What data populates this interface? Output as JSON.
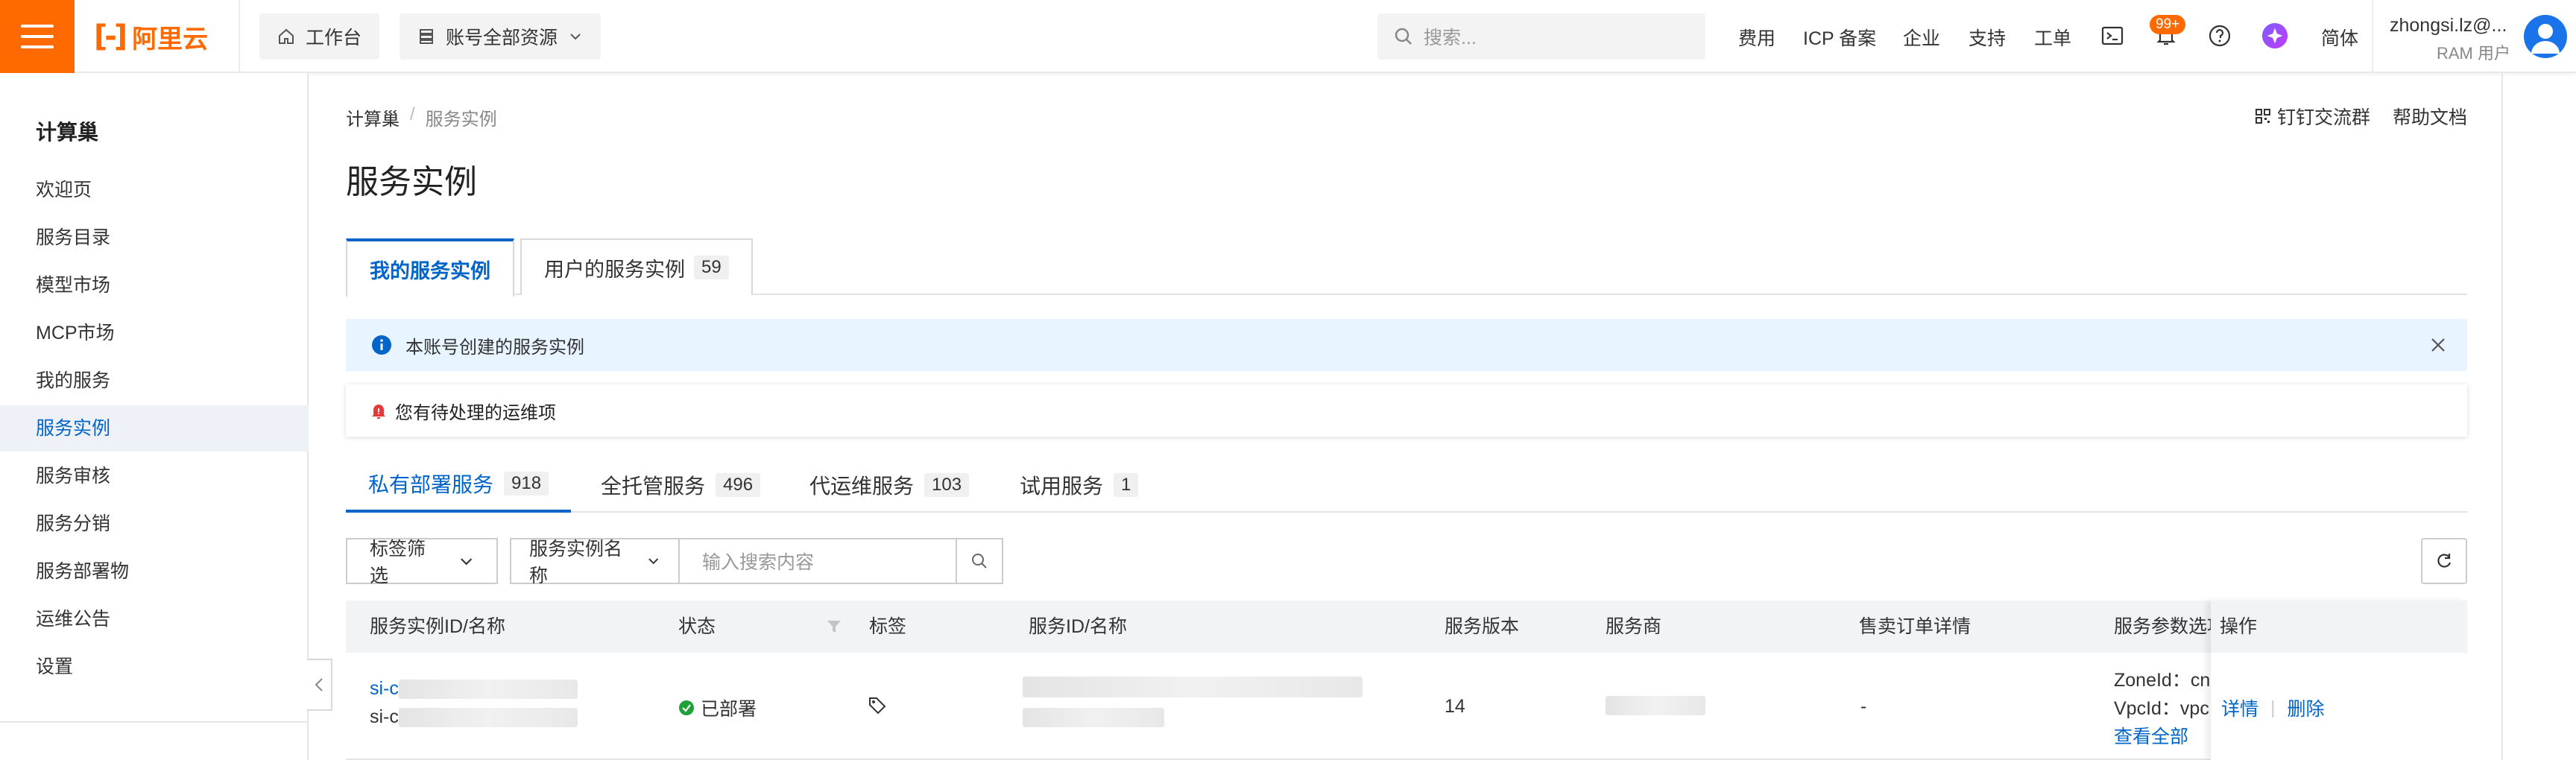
{
  "topbar": {
    "logo_text": "阿里云",
    "workbench": "工作台",
    "resources": "账号全部资源",
    "search_placeholder": "搜索...",
    "links": [
      "费用",
      "ICP 备案",
      "企业",
      "支持",
      "工单"
    ],
    "notification_badge": "99+",
    "language": "简体",
    "user_name": "zhongsi.lz@...",
    "user_role": "RAM 用户"
  },
  "sidebar": {
    "title": "计算巢",
    "items": [
      "欢迎页",
      "服务目录",
      "模型市场",
      "MCP市场",
      "我的服务",
      "服务实例",
      "服务审核",
      "服务分销",
      "服务部署物",
      "运维公告",
      "设置"
    ],
    "active_index": 5
  },
  "main": {
    "breadcrumb": [
      "计算巢",
      "服务实例"
    ],
    "header_links": [
      "钉钉交流群",
      "帮助文档"
    ],
    "title": "服务实例",
    "tabs": [
      {
        "label": "我的服务实例",
        "count": ""
      },
      {
        "label": "用户的服务实例",
        "count": "59"
      }
    ],
    "info_text": "本账号创建的服务实例",
    "todo_text": "您有待处理的运维项",
    "sub_tabs": [
      {
        "label": "私有部署服务",
        "count": "918"
      },
      {
        "label": "全托管服务",
        "count": "496"
      },
      {
        "label": "代运维服务",
        "count": "103"
      },
      {
        "label": "试用服务",
        "count": "1"
      }
    ],
    "filters": {
      "tag_filter": "标签筛选",
      "field_select": "服务实例名称",
      "search_placeholder": "输入搜索内容"
    },
    "table": {
      "headers": [
        "服务实例ID/名称",
        "状态",
        "标签",
        "服务ID/名称",
        "服务版本",
        "服务商",
        "售卖订单详情",
        "服务参数选项",
        "操作"
      ],
      "rows": [
        {
          "id_prefix": "si-c",
          "name_prefix": "si-c",
          "status": "已部署",
          "version": "14",
          "order": "-",
          "param_zone": "ZoneId：cn",
          "param_vpc": "VpcId：vpc",
          "view_all": "查看全部",
          "action_detail": "详情",
          "action_delete": "删除"
        }
      ]
    }
  },
  "colors": {
    "brand": "#ff6a00",
    "primary": "#0064c8",
    "success": "#1fa138"
  }
}
